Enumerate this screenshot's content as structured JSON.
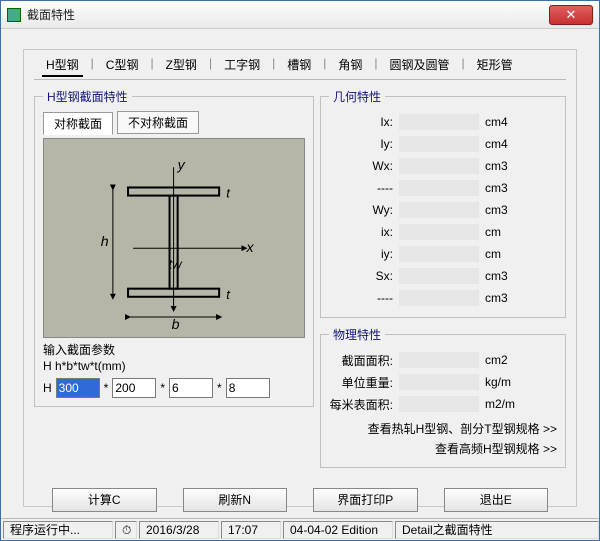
{
  "window": {
    "title": "截面特性"
  },
  "tabs": [
    "H型钢",
    "C型钢",
    "Z型钢",
    "工字钢",
    "槽钢",
    "角钢",
    "圆钢及圆管",
    "矩形管"
  ],
  "activeTabIndex": 0,
  "left": {
    "group_title": "H型钢截面特性",
    "subtabs": [
      "对称截面",
      "不对称截面"
    ],
    "activeSubtab": 0,
    "param_header1": "输入截面参数",
    "param_header2": "H  h*b*tw*t(mm)",
    "param_label": "H",
    "params": {
      "h": "300",
      "b": "200",
      "tw": "6",
      "t": "8"
    },
    "star": "*"
  },
  "geom": {
    "title": "几何特性",
    "rows": [
      {
        "lab": "Ix:",
        "val": "",
        "unit": "cm4"
      },
      {
        "lab": "Iy:",
        "val": "",
        "unit": "cm4"
      },
      {
        "lab": "Wx:",
        "val": "",
        "unit": "cm3"
      },
      {
        "lab": "----",
        "val": "",
        "unit": "cm3"
      },
      {
        "lab": "Wy:",
        "val": "",
        "unit": "cm3"
      },
      {
        "lab": "ix:",
        "val": "",
        "unit": "cm"
      },
      {
        "lab": "iy:",
        "val": "",
        "unit": "cm"
      },
      {
        "lab": "Sx:",
        "val": "",
        "unit": "cm3"
      },
      {
        "lab": "----",
        "val": "",
        "unit": "cm3"
      }
    ]
  },
  "phys": {
    "title": "物理特性",
    "rows": [
      {
        "lab": "截面面积:",
        "val": "",
        "unit": "cm2"
      },
      {
        "lab": "单位重量:",
        "val": "",
        "unit": "kg/m"
      },
      {
        "lab": "每米表面积:",
        "val": "",
        "unit": "m2/m"
      }
    ],
    "link1": "查看热轧H型钢、剖分T型钢规格 >>",
    "link2": "查看高频H型钢规格 >>"
  },
  "buttons": {
    "calc": "计算C",
    "refresh": "刷新N",
    "print": "界面打印P",
    "exit": "退出E"
  },
  "status": {
    "running": "程序运行中...",
    "date": "2016/3/28",
    "time": "17:07",
    "edition": "04-04-02 Edition",
    "module": "Detail之截面特性"
  }
}
